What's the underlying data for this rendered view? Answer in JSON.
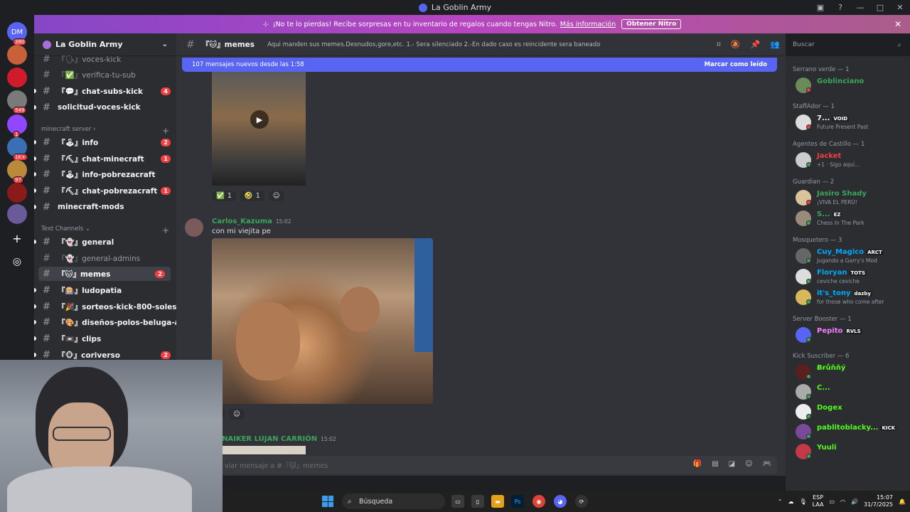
{
  "window": {
    "title": "La Goblin Army"
  },
  "servers": [
    {
      "label": "DM",
      "badge": "380",
      "color": "#5865f2"
    },
    {
      "label": "",
      "badge": "",
      "color": "#c8613a"
    },
    {
      "label": "",
      "badge": "",
      "color": "#d01b2a"
    },
    {
      "label": "",
      "badge": "549",
      "color": "#7a7a7a"
    },
    {
      "label": "",
      "badge": "1",
      "color": "#9146ff"
    },
    {
      "label": "",
      "badge": "1K+",
      "color": "#3a6fb5"
    },
    {
      "label": "",
      "badge": "97",
      "color": "#b88a3a"
    },
    {
      "label": "",
      "badge": "",
      "color": "#8b1a1a"
    },
    {
      "label": "",
      "badge": "",
      "color": "#6a5a9a"
    }
  ],
  "guild": {
    "name": "La Goblin Army"
  },
  "channels_top": [
    {
      "name": "『🗣』voces-kick",
      "unread": false,
      "count": ""
    },
    {
      "name": "『✅』verifica-tu-sub",
      "unread": false,
      "count": ""
    },
    {
      "name": "『💬』chat-subs-kick",
      "unread": true,
      "count": "4"
    },
    {
      "name": "solicitud-voces-kick",
      "unread": true,
      "count": ""
    }
  ],
  "category_minecraft": "minecraft server",
  "channels_minecraft": [
    {
      "name": "『🕹』info",
      "unread": true,
      "count": "2"
    },
    {
      "name": "『⛏』chat-minecraft",
      "unread": true,
      "count": "1"
    },
    {
      "name": "『🕹』info-pobrezacraft",
      "unread": true,
      "count": ""
    },
    {
      "name": "『⛏』chat-pobrezacraft",
      "unread": true,
      "count": "1"
    },
    {
      "name": "minecraft-mods",
      "unread": true,
      "count": ""
    }
  ],
  "category_text": "Text Channels",
  "channels_text": [
    {
      "name": "『👻』general",
      "unread": true,
      "count": ""
    },
    {
      "name": "『👻』general-admins",
      "unread": false,
      "count": ""
    },
    {
      "name": "『🐱』memes",
      "unread": true,
      "count": "2",
      "active": true
    },
    {
      "name": "『🎰』ludopatia",
      "unread": true,
      "count": ""
    },
    {
      "name": "『🎉』sorteos-kick-800-soles",
      "unread": true,
      "count": ""
    },
    {
      "name": "『🎨』diseños-polos-beluga-ar...",
      "unread": true,
      "count": ""
    },
    {
      "name": "『📼』clips",
      "unread": true,
      "count": ""
    },
    {
      "name": "『🐵』coriverso",
      "unread": true,
      "count": "2"
    }
  ],
  "nitro": {
    "text": "¡No te lo pierdas! Recibe sorpresas en tu inventario de regalos cuando tengas Nitro.",
    "link": "Más información",
    "button": "Obtener Nitro"
  },
  "header": {
    "channel": "『🐱』memes",
    "topic": "Aqui manden sus memes.Desnudos,gore,etc. 1.- Sera silenciado 2.-En dado caso es reincidente sera baneado",
    "search_placeholder": "Buscar"
  },
  "new_messages": {
    "text": "107 mensajes nuevos desde las 1:58",
    "mark": "Marcar como leído"
  },
  "message1": {
    "reactions": [
      {
        "emoji": "✅",
        "count": "1"
      },
      {
        "emoji": "🤣",
        "count": "1"
      }
    ]
  },
  "message2": {
    "author": "Carlos_Kazuma",
    "time": "15:02",
    "text": "con mi viejita pe",
    "reactions": [
      {
        "emoji": "",
        "count": "1"
      }
    ]
  },
  "message3": {
    "author": "NAIKER LUJAN CARRIÓN",
    "time": "15:02"
  },
  "composer": {
    "placeholder": "viar mensaje a #『🐱』memes"
  },
  "members": [
    {
      "category": "Serrano verde — 1",
      "items": [
        {
          "name": "Goblinciano",
          "status": "",
          "tag": "",
          "color": "#3ba55c",
          "avatar": "#6b8a5a",
          "presence": "#f23f43"
        }
      ]
    },
    {
      "category": "StaffAdor — 1",
      "items": [
        {
          "name": "7...",
          "status": "Future Present Past",
          "tag": "VOID",
          "color": "#f2f3f5",
          "avatar": "#ddd",
          "presence": "#f23f43"
        }
      ]
    },
    {
      "category": "Agentes de Castillo — 1",
      "items": [
        {
          "name": "Jacket",
          "status": "+1 · Sigo aquí...",
          "tag": "",
          "color": "#f23f43",
          "avatar": "#ccc",
          "presence": "#3ba55c"
        }
      ]
    },
    {
      "category": "Guardian — 2",
      "items": [
        {
          "name": "Jasiro Shady",
          "status": "¡VIVA EL PERÚ!",
          "tag": "",
          "color": "#3ba55c",
          "avatar": "#d9c39a",
          "presence": "#f23f43"
        },
        {
          "name": "S...",
          "status": "Chess In The Park",
          "tag": "EZ",
          "color": "#3ba55c",
          "avatar": "#9a8a7a",
          "presence": "#3ba55c"
        }
      ]
    },
    {
      "category": "Mosquetero — 3",
      "items": [
        {
          "name": "Cuy_Magico",
          "status": "Jugando a Garry's Mod",
          "tag": "ARCT",
          "color": "#00a8fc",
          "avatar": "#666",
          "presence": "#3ba55c"
        },
        {
          "name": "Floryan",
          "status": "ceviche ceviche",
          "tag": "TOTS",
          "color": "#00a8fc",
          "avatar": "#ddd",
          "presence": "#3ba55c"
        },
        {
          "name": "it's_tony",
          "status": "for those who come after",
          "tag": "dazby",
          "color": "#00a8fc",
          "avatar": "#d9b75a",
          "presence": "#3ba55c"
        }
      ]
    },
    {
      "category": "Server Booster — 1",
      "items": [
        {
          "name": "Pepito",
          "status": "",
          "tag": "RVLS",
          "color": "#f47fff",
          "avatar": "#5865f2",
          "presence": "#3ba55c"
        }
      ]
    },
    {
      "category": "Kick Suscriber — 6",
      "items": [
        {
          "name": "Ƀɍůňňý",
          "status": "",
          "tag": "",
          "color": "#53fc18",
          "avatar": "#5a2020",
          "presence": "#3ba55c"
        },
        {
          "name": "C...",
          "status": "",
          "tag": "",
          "color": "#53fc18",
          "avatar": "#aaa",
          "presence": "#3ba55c"
        },
        {
          "name": "Dogex",
          "status": "",
          "tag": "",
          "color": "#53fc18",
          "avatar": "#eee",
          "presence": "#3ba55c"
        },
        {
          "name": "pablitoblacky...",
          "status": "",
          "tag": "KICK",
          "color": "#53fc18",
          "avatar": "#7a4a9a",
          "presence": "#3ba55c"
        },
        {
          "name": "Yuuli",
          "status": "",
          "tag": "",
          "color": "#53fc18",
          "avatar": "#c23a4a",
          "presence": "#3ba55c"
        }
      ]
    }
  ],
  "taskbar": {
    "search": "Búsqueda",
    "lang1": "ESP",
    "lang2": "LAA",
    "time": "15:07",
    "date": "31/7/2025"
  }
}
